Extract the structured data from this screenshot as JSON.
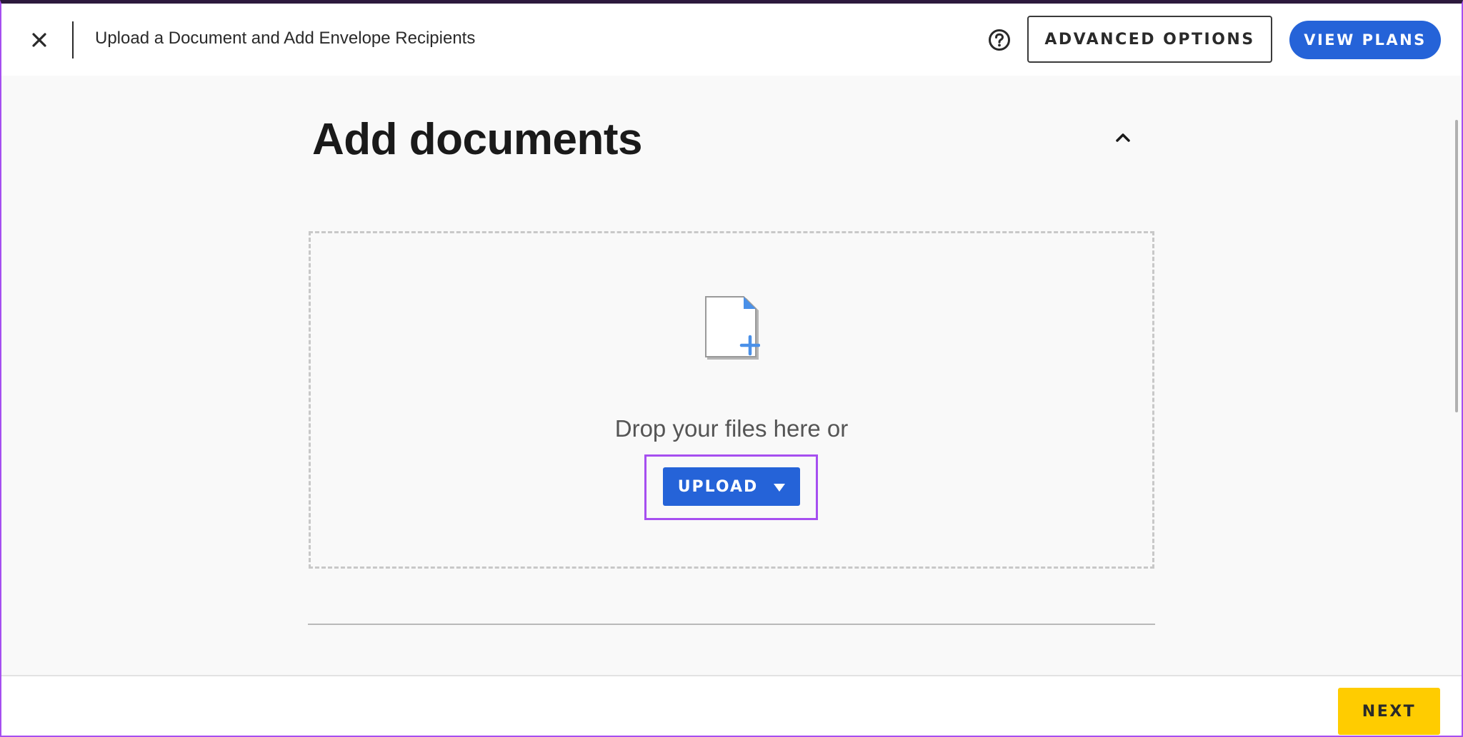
{
  "header": {
    "title": "Upload a Document and Add Envelope Recipients",
    "close_icon": "close-icon",
    "help_icon": "help-circle-icon",
    "advanced_options_label": "ADVANCED OPTIONS",
    "view_plans_label": "VIEW PLANS"
  },
  "main": {
    "title": "Add documents",
    "collapse_icon": "chevron-up-icon",
    "dropzone": {
      "icon": "add-file-icon",
      "prompt": "Drop your files here or",
      "upload_label": "UPLOAD",
      "upload_caret_icon": "caret-down-icon"
    }
  },
  "footer": {
    "next_label": "NEXT"
  },
  "colors": {
    "primary_blue": "#2563d8",
    "next_yellow": "#ffcc00",
    "highlight_purple": "#a64ff0",
    "background": "#f9f9f9"
  }
}
